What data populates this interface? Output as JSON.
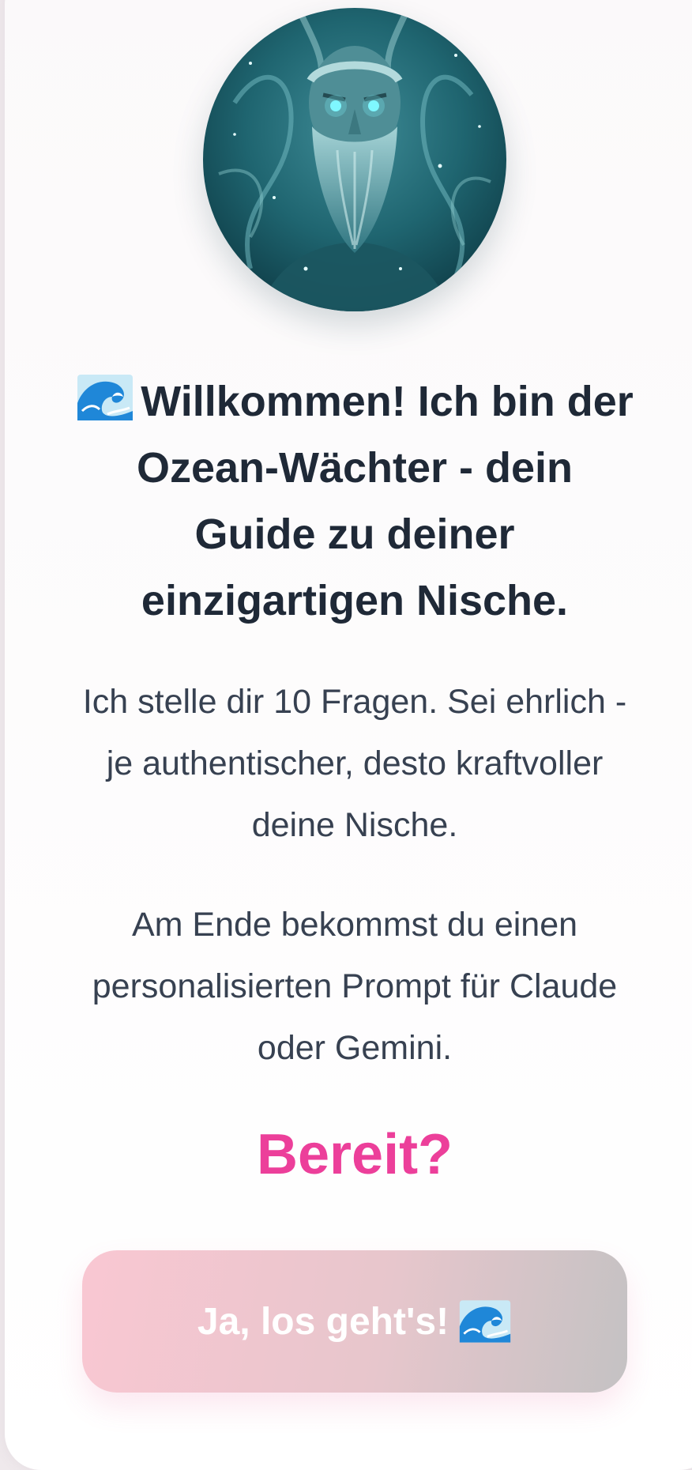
{
  "welcome": {
    "avatar_icon": "ocean-guardian-avatar",
    "wave_icon": "water-wave-icon",
    "title": "Willkommen! Ich bin der Ozean-Wächter - dein Guide zu deiner einzigartigen Nische.",
    "intro": "Ich stelle dir 10 Fragen. Sei ehrlich - je authentischer, desto kraftvoller deine Nische.",
    "outcome": "Am Ende bekommst du einen personalisierten Prompt für Claude oder Gemini.",
    "question": "Bereit?",
    "cta_label": "Ja, los geht's!"
  },
  "colors": {
    "heading": "#1f2937",
    "body_text": "#374151",
    "accent_pink": "#ec3f9a",
    "button_gradient_start": "#f9c7d2",
    "button_gradient_end": "#c4c2c3"
  }
}
